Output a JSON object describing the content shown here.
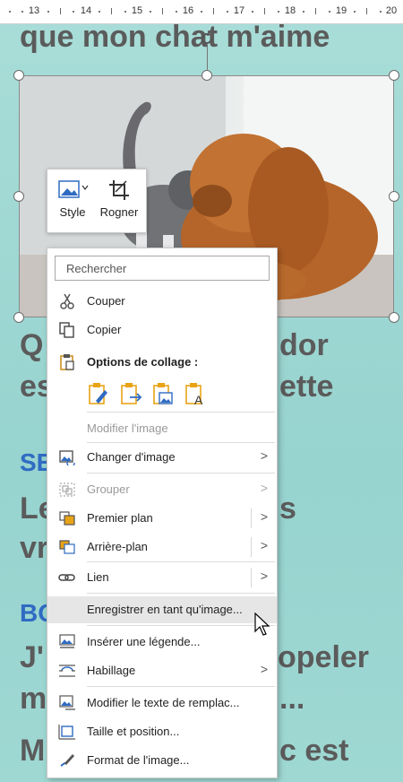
{
  "ruler": {
    "numbers": [
      "13",
      "14",
      "15",
      "16",
      "17",
      "18",
      "19",
      "20"
    ]
  },
  "document": {
    "title_line": "que mon chat m'aime",
    "para1_line1": "Q",
    "para1_line1_end": "dor",
    "para1_line2": "es",
    "para1_line2_end": "ette",
    "heading2": "SE",
    "para2_line1": "Le",
    "para2_line1_end": "s",
    "para2_line2": "vr",
    "heading3": "BO",
    "para3_line1": "J'",
    "para3_line1_end": "opeler",
    "para3_line2": "m",
    "para3_line2_end": "...",
    "para4_line1": "M",
    "para4_line1_end": "c est"
  },
  "mini_toolbar": {
    "style_label": "Style",
    "crop_label": "Rogner"
  },
  "context_menu": {
    "search_placeholder": "Rechercher",
    "cut": "Couper",
    "copy": "Copier",
    "paste_options": "Options de collage :",
    "edit_image": "Modifier l'image",
    "change_image": "Changer d'image",
    "group": "Grouper",
    "bring_front": "Premier plan",
    "send_back": "Arrière-plan",
    "link": "Lien",
    "save_as_image": "Enregistrer en tant qu'image...",
    "insert_caption": "Insérer une légende...",
    "wrap_text": "Habillage",
    "alt_text": "Modifier le texte de remplac...",
    "size_position": "Taille et position...",
    "format_image": "Format de l'image..."
  },
  "colors": {
    "heading_blue": "#2f6bc2",
    "body_gray": "#5b5b5b",
    "accent_orange": "#e8a317"
  }
}
